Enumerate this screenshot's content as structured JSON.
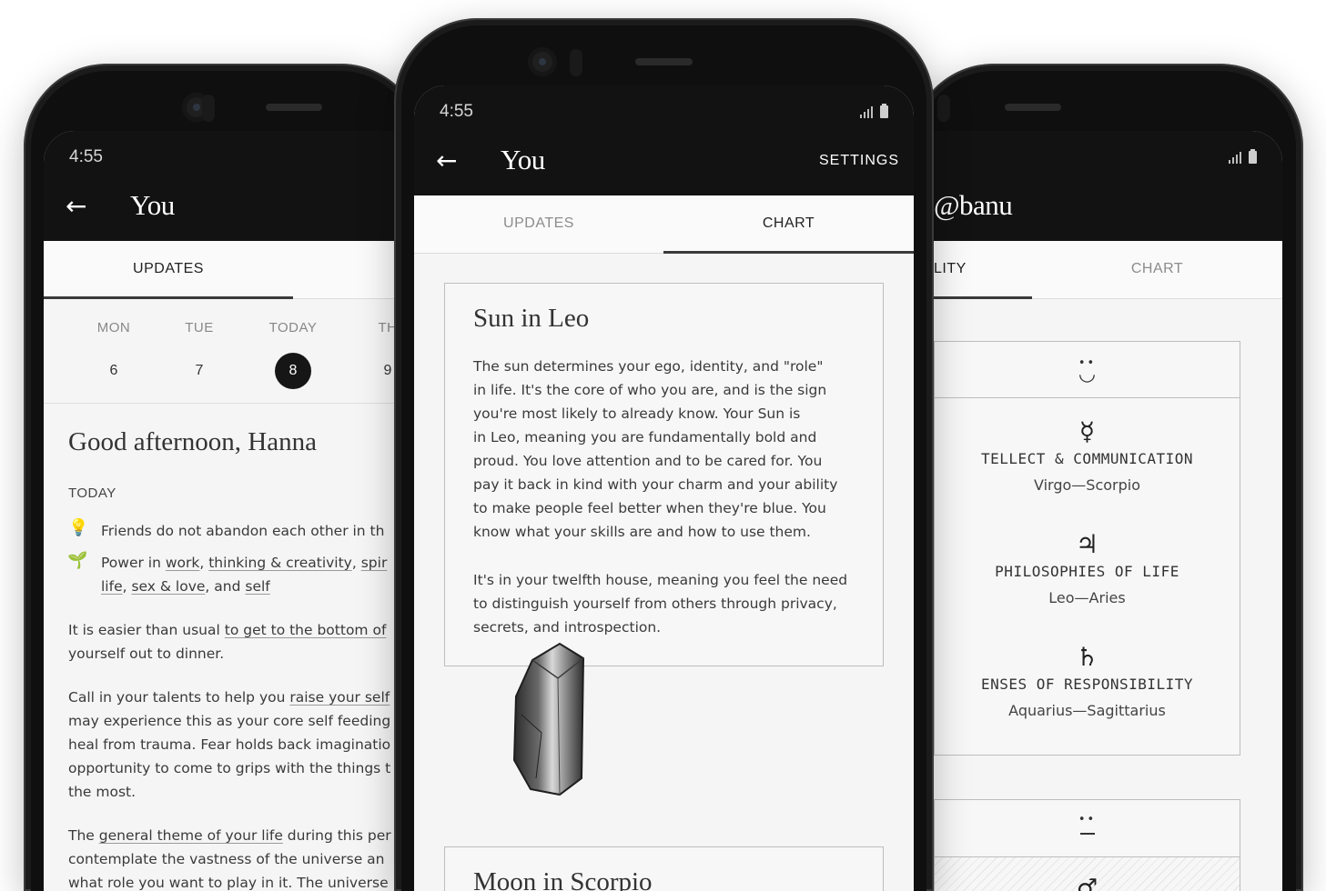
{
  "status": {
    "time": "4:55"
  },
  "left_phone": {
    "title": "You",
    "tabs": {
      "updates": "UPDATES"
    },
    "week": [
      {
        "name": "MON",
        "date": "6"
      },
      {
        "name": "TUE",
        "date": "7"
      },
      {
        "name": "TODAY",
        "date": "8"
      },
      {
        "name": "TH",
        "date": "9"
      }
    ],
    "greeting": "Good afternoon, Hanna",
    "section_label": "TODAY",
    "items": {
      "friends": "Friends do not abandon each other in th",
      "power_prefix": "Power in ",
      "power_work": "work",
      "power_sep1": ", ",
      "power_thinking": "thinking & creativity",
      "power_sep2": ", ",
      "power_spir": "spir",
      "power_life": "life",
      "power_sep3": ", ",
      "power_sex": "sex & love",
      "power_sep4": ", and ",
      "power_self": "self"
    },
    "para1": {
      "pre": "It is easier than usual ",
      "link": "to get to the bottom of",
      "line2": "yourself out to dinner."
    },
    "para2": {
      "pre": "Call in your talents to help you ",
      "link": "raise your self",
      "l2": "may experience this as your core self feeding",
      "l3": "heal from trauma. Fear holds back imaginatio",
      "l4": "opportunity to come to grips with the things t",
      "l5": "the most."
    },
    "para3": {
      "pre": "The ",
      "link": "general theme of your life",
      "post": " during this per",
      "l2": "contemplate the vastness of the universe an",
      "l3": "what role you want to play in it. The universe"
    }
  },
  "center_phone": {
    "title": "You",
    "settings": "SETTINGS",
    "tabs": {
      "updates": "UPDATES",
      "chart": "CHART"
    },
    "card1": {
      "heading": "Sun in Leo",
      "p1": [
        "The sun determines your ego, identity, and \"role\"",
        "in life. It's the core of who you are, and is the sign",
        "you're most likely to already know. Your Sun is",
        "in Leo, meaning you are fundamentally bold and",
        "proud. You love attention and to be cared for. You",
        "pay it back in kind with your charm and your ability",
        "to make people feel better when they're blue. You",
        "know what your skills are and how to use them."
      ],
      "p2": [
        "It's in your twelfth house, meaning you feel the need",
        "to distinguish yourself from others through privacy,",
        "secrets, and introspection."
      ]
    },
    "card2": {
      "heading": "Moon in Scorpio"
    }
  },
  "right_phone": {
    "title": "@banu",
    "tabs": {
      "left": "LITY",
      "chart": "CHART"
    },
    "rows": [
      {
        "glyph": "☿",
        "label": "TELLECT & COMMUNICATION",
        "signs": "Virgo—Scorpio"
      },
      {
        "glyph": "♃",
        "label": "PHILOSOPHIES OF LIFE",
        "signs": "Leo—Aries"
      },
      {
        "glyph": "♄",
        "label": "ENSES OF RESPONSIBILITY",
        "signs": "Aquarius—Sagittarius"
      }
    ],
    "face_top": "◡",
    "bottom_glyph": "♂"
  }
}
